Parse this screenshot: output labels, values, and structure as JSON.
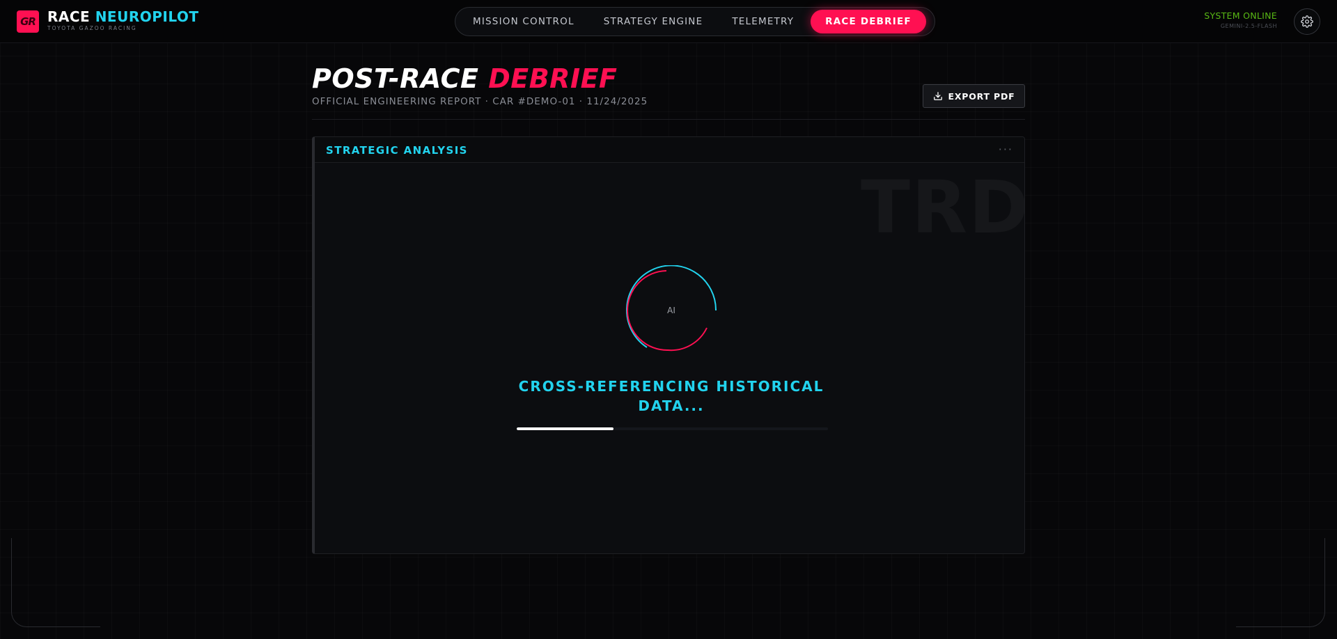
{
  "header": {
    "logo_text": "GR",
    "brand_primary": "RACE",
    "brand_accent": "NEUROPILOT",
    "brand_sub": "TOYOTA GAZOO RACING",
    "nav": [
      {
        "label": "MISSION CONTROL",
        "active": false
      },
      {
        "label": "STRATEGY ENGINE",
        "active": false
      },
      {
        "label": "TELEMETRY",
        "active": false
      },
      {
        "label": "RACE DEBRIEF",
        "active": true
      }
    ],
    "status": "SYSTEM ONLINE",
    "model": "GEMINI-2.5-FLASH",
    "settings_icon": "gear-icon"
  },
  "page": {
    "title_primary": "POST-RACE",
    "title_accent": "DEBRIEF",
    "subtitle": "OFFICIAL ENGINEERING REPORT · CAR #DEMO-01 · 11/24/2025",
    "export_label": "EXPORT PDF",
    "export_icon": "download-icon"
  },
  "panel": {
    "title": "STRATEGIC ANALYSIS",
    "menu": "···",
    "watermark": "TRD",
    "spinner_label": "AI",
    "loading_text": "CROSS-REFERENCING HISTORICAL DATA...",
    "progress": 0.31
  },
  "colors": {
    "accent_red": "#ff1052",
    "accent_cyan": "#22d3ee",
    "status_green": "#58b814",
    "background": "#070709"
  }
}
